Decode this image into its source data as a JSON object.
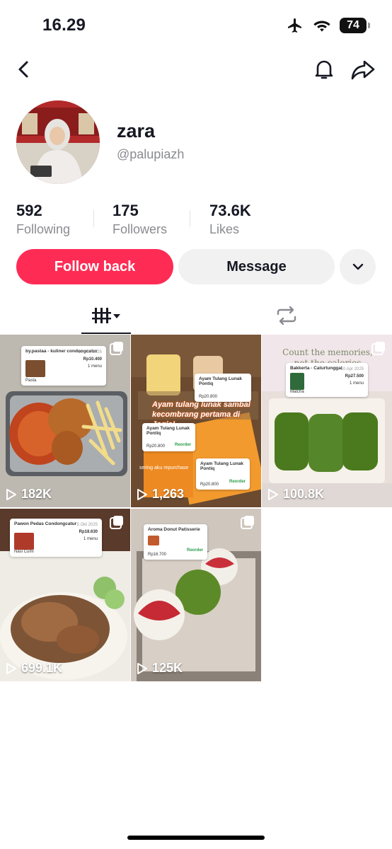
{
  "status_bar": {
    "time": "16.29",
    "battery": "74"
  },
  "profile": {
    "name": "zara",
    "handle": "@palupiazh"
  },
  "stats": {
    "following": {
      "value": "592",
      "label": "Following"
    },
    "followers": {
      "value": "175",
      "label": "Followers"
    },
    "likes": {
      "value": "73.6K",
      "label": "Likes"
    }
  },
  "actions": {
    "follow_back": "Follow back",
    "message": "Message"
  },
  "videos": [
    {
      "views": "182K",
      "card": {
        "title": "by.pastaa - kuliner condongcatur",
        "date": "16 Des 2025",
        "price": "Rp10.400",
        "sub": "1 menu",
        "item": "Pasta"
      }
    },
    {
      "views": "1,263",
      "overlay": "Ayam tulang lunak sambal kecombrang pertama di Jogja!",
      "caption": "sering aku repurchase",
      "card": {
        "title": "Ayam Tulang Lunak Pontiq",
        "price": "Rp20.800",
        "sub": "Reorder"
      }
    },
    {
      "views": "100.8K",
      "card_text": "Count the memories, not the calories",
      "card": {
        "title": "Bakkerta - Caturtunggal",
        "date": "10 Apr 2025",
        "price": "Rp27.500",
        "sub": "1 menu",
        "item": "Matcha"
      }
    },
    {
      "views": "699.1K",
      "card": {
        "title": "Pawon Pedas Condongcatur",
        "date": "5 Okt 2025",
        "price": "Rp18.630",
        "sub": "1 menu",
        "item": "Nasi Cumi"
      }
    },
    {
      "views": "125K",
      "card": {
        "title": "Aroma Donut Patisserie",
        "price": "Rp16.700",
        "sub": "Reorder"
      }
    }
  ]
}
